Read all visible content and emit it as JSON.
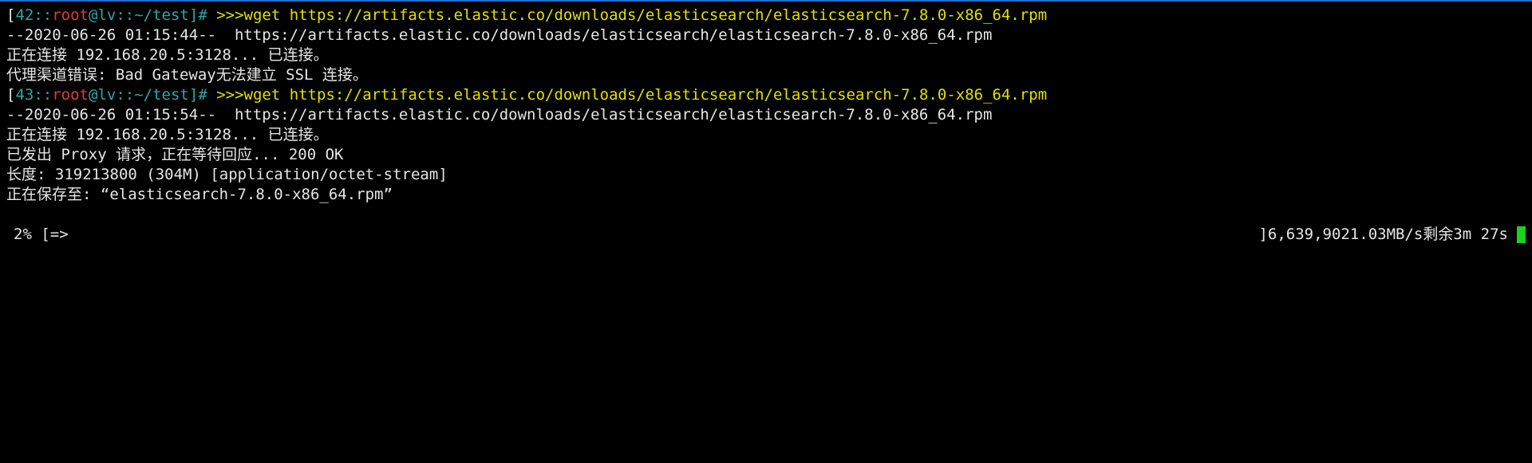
{
  "window": {
    "accent_color": "#1e6fd0",
    "background": "#000000"
  },
  "prompts": [
    {
      "open_bracket": "[",
      "num": "42",
      "sep1": "::",
      "user": "root",
      "at": "@",
      "host": "lv",
      "sep2": "::",
      "path": "~/test",
      "close": "]#",
      "arrows": " >>>",
      "command": "wget https://artifacts.elastic.co/downloads/elasticsearch/elasticsearch-7.8.0-x86_64.rpm"
    },
    {
      "open_bracket": "[",
      "num": "43",
      "sep1": "::",
      "user": "root",
      "at": "@",
      "host": "lv",
      "sep2": "::",
      "path": "~/test",
      "close": "]#",
      "arrows": " >>>",
      "command": "wget https://artifacts.elastic.co/downloads/elasticsearch/elasticsearch-7.8.0-x86_64.rpm"
    }
  ],
  "output_block_1": [
    "--2020-06-26 01:15:44--  https://artifacts.elastic.co/downloads/elasticsearch/elasticsearch-7.8.0-x86_64.rpm",
    "正在连接 192.168.20.5:3128... 已连接。",
    "代理渠道错误: Bad Gateway无法建立 SSL 连接。"
  ],
  "output_block_2": [
    "--2020-06-26 01:15:54--  https://artifacts.elastic.co/downloads/elasticsearch/elasticsearch-7.8.0-x86_64.rpm",
    "正在连接 192.168.20.5:3128... 已连接。",
    "已发出 Proxy 请求，正在等待回应... 200 OK",
    "长度: 319213800 (304M) [application/octet-stream]",
    "正在保存至: “elasticsearch-7.8.0-x86_64.rpm”"
  ],
  "progress": {
    "percent_text": "2%",
    "bar_text": "[=>",
    "percent_value": 2,
    "bar_end": "]",
    "bytes": "6,639,902",
    "speed": "1.03MB/s",
    "eta_label": "剩余",
    "eta": "3m 27s",
    "cursor_color": "#19d219"
  }
}
